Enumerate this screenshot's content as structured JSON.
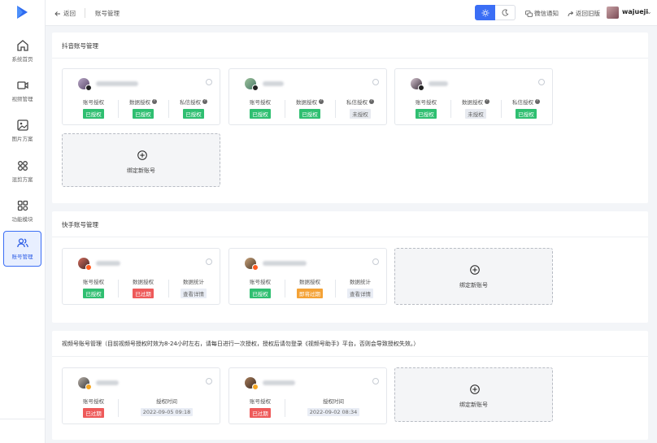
{
  "header": {
    "back_label": "返回",
    "breadcrumb": "账号管理",
    "wechat_notify": "微信通知",
    "old_version": "返回旧版",
    "username": "wajueji"
  },
  "sidebar": {
    "items": [
      {
        "label": "系统首页",
        "icon": "home-icon"
      },
      {
        "label": "视频管理",
        "icon": "video-icon"
      },
      {
        "label": "图片方案",
        "icon": "image-icon"
      },
      {
        "label": "混剪方案",
        "icon": "grid-icon"
      },
      {
        "label": "功能模块",
        "icon": "modules-icon"
      },
      {
        "label": "账号管理",
        "icon": "users-icon",
        "active": true
      }
    ]
  },
  "douyin": {
    "title": "抖音账号管理",
    "col_labels": [
      "账号授权",
      "数据授权",
      "私信授权"
    ],
    "cards": [
      {
        "tags": [
          "已授权",
          "已授权",
          "已授权"
        ],
        "states": [
          "green",
          "green",
          "green"
        ]
      },
      {
        "tags": [
          "已授权",
          "已授权",
          "未授权"
        ],
        "states": [
          "green",
          "green",
          "gray"
        ]
      },
      {
        "tags": [
          "已授权",
          "未授权",
          "已授权"
        ],
        "states": [
          "green",
          "gray",
          "green"
        ]
      }
    ],
    "add_label": "绑定新账号"
  },
  "kuaishou": {
    "title": "快手账号管理",
    "col_labels": [
      "账号授权",
      "数据授权",
      "数据统计"
    ],
    "cards": [
      {
        "tags": [
          "已授权",
          "已过期",
          "查看详情"
        ],
        "states": [
          "green",
          "red",
          "plain"
        ]
      },
      {
        "tags": [
          "已授权",
          "即将过期",
          "查看详情"
        ],
        "states": [
          "green",
          "orange",
          "plain"
        ]
      }
    ],
    "add_label": "绑定新账号"
  },
  "shipinhao": {
    "title": "视频号账号管理（目前视频号授权时效为8-24小时左右，请每日进行一次授权，授权后请勿登录《视频号助手》平台，否则会导致授权失效。）",
    "col_labels": [
      "账号授权",
      "授权时间"
    ],
    "cards": [
      {
        "status": "已过期",
        "time": "2022-09-05 09:18"
      },
      {
        "status": "已过期",
        "time": "2022-09-02 08:34"
      }
    ],
    "add_label": "绑定新账号"
  },
  "colors": {
    "accent": "#3b6ef5",
    "success": "#2fbf71",
    "danger": "#ee5a5a",
    "warning": "#f4a236"
  }
}
